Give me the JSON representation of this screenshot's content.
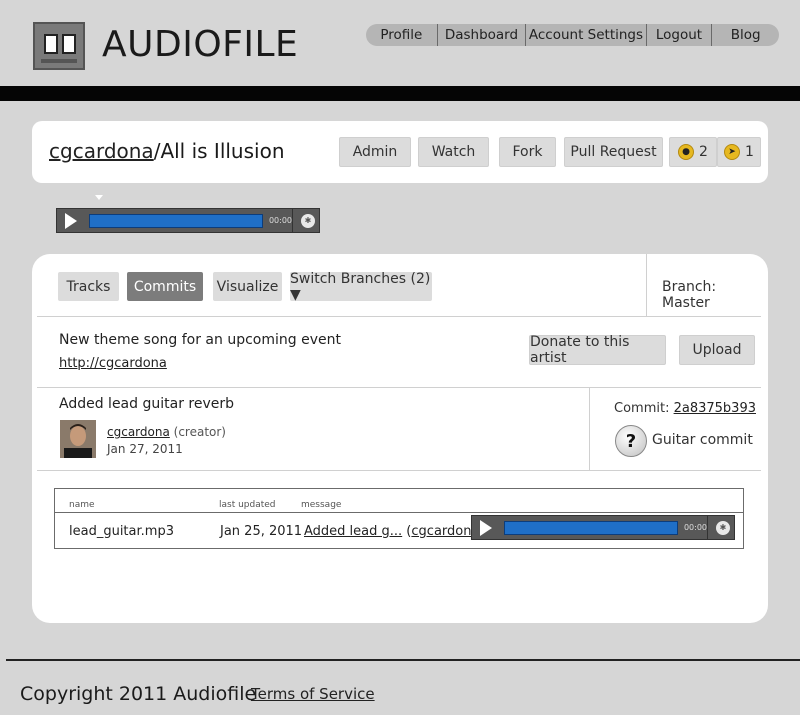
{
  "brand": {
    "name": "AUDIOFILE",
    "icon": "audiofile-logo-icon"
  },
  "nav": {
    "profile": "Profile",
    "dashboard": "Dashboard",
    "account_settings": "Account Settings",
    "logout": "Logout",
    "blog": "Blog"
  },
  "repo": {
    "owner": "cgcardona",
    "separator": "/",
    "name": "All is Illusion",
    "buttons": {
      "admin": "Admin",
      "watch": "Watch",
      "fork": "Fork",
      "pull_request": "Pull Request"
    },
    "watchers_count": "2",
    "forks_count": "1"
  },
  "player": {
    "time": "00:00"
  },
  "tabs": {
    "tracks": "Tracks",
    "commits": "Commits",
    "visualize": "Visualize",
    "switch_branches": "Switch Branches (2) ▼"
  },
  "branch": "Branch: Master",
  "description": {
    "text": "New theme song for an upcoming event",
    "link": "http://cgcardona",
    "donate": "Donate to this artist",
    "upload": "Upload"
  },
  "commit": {
    "message": "Added lead guitar reverb",
    "author": "cgcardona",
    "role": "(creator)",
    "date": "Jan 27, 2011",
    "label": "Commit:",
    "id": "2a8375b393",
    "title": "Guitar commit"
  },
  "files": {
    "headers": {
      "name": "name",
      "updated": "last updated",
      "message": "message"
    },
    "rows": [
      {
        "name": "lead_guitar.mp3",
        "updated": "Jan 25, 2011",
        "message": "Added lead g...",
        "author": "cgcardona"
      }
    ]
  },
  "footer": {
    "copyright": "Copyright 2011 Audiofile",
    "terms": "Terms of Service"
  },
  "colors": {
    "header_bar": "#050505",
    "player_progress": "#1f6fc7",
    "active_tab": "#7c7c7c"
  }
}
